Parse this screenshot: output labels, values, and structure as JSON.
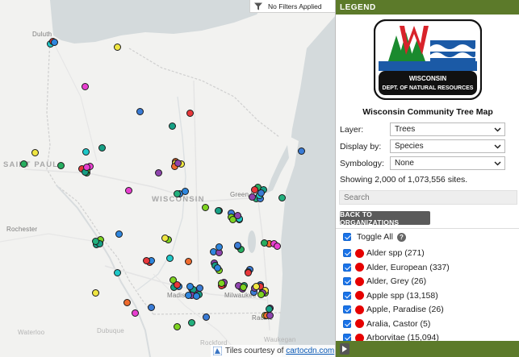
{
  "filter_bar": {
    "icon": "funnel-icon",
    "text": "No Filters Applied"
  },
  "attribution": {
    "prefix": "Tiles courtesy of",
    "link": "cartocdn.com"
  },
  "map_labels": [
    {
      "text": "Duluth",
      "cls": "city"
    },
    {
      "text": "SAINT PAUL",
      "cls": "state"
    },
    {
      "text": "WISCONSIN",
      "cls": "state"
    },
    {
      "text": "Green Bay",
      "cls": "city"
    },
    {
      "text": "Rochester",
      "cls": "city"
    },
    {
      "text": "Madison",
      "cls": "city"
    },
    {
      "text": "Milwaukee",
      "cls": "city"
    },
    {
      "text": "Racine",
      "cls": "city"
    },
    {
      "text": "Waterloo",
      "cls": "dim"
    },
    {
      "text": "Dubuque",
      "cls": "dim"
    },
    {
      "text": "Rockford",
      "cls": "dim"
    },
    {
      "text": "Waukegan",
      "cls": "dim"
    }
  ],
  "marker_colors": [
    "#3a7bd5",
    "#22b07d",
    "#7ed321",
    "#1ec8c8",
    "#e83fd0",
    "#ef6b2d",
    "#e8373a",
    "#f0e642",
    "#8e44ad",
    "#2e86de",
    "#27ae60",
    "#16a085"
  ],
  "legend": {
    "header": "LEGEND",
    "logo": {
      "org_line1": "WISCONSIN",
      "org_line2": "DEPT. OF NATURAL RESOURCES",
      "letter": "W"
    },
    "title": "Wisconsin Community Tree Map",
    "layer": {
      "label": "Layer:",
      "value": "Trees"
    },
    "display_by": {
      "label": "Display by:",
      "value": "Species"
    },
    "symbology": {
      "label": "Symbology:",
      "value": "None"
    },
    "showing": "Showing 2,000 of 1,073,556 sites.",
    "search_placeholder": "Search",
    "back_button": "BACK TO ORGANIZATIONS",
    "toggle_all": "Toggle All",
    "help_icon": "?",
    "species": [
      {
        "label": "Alder spp (271)",
        "color": "#e60000"
      },
      {
        "label": "Alder, European (337)",
        "color": "#e60000"
      },
      {
        "label": "Alder, Grey (26)",
        "color": "#e60000"
      },
      {
        "label": "Apple spp (13,158)",
        "color": "#e60000"
      },
      {
        "label": "Apple, Paradise (26)",
        "color": "#e60000"
      },
      {
        "label": "Aralia, Castor (5)",
        "color": "#e60000"
      },
      {
        "label": "Arborvitae (15,094)",
        "color": "#e60000"
      }
    ],
    "accent_color": "#5c7a2a"
  }
}
